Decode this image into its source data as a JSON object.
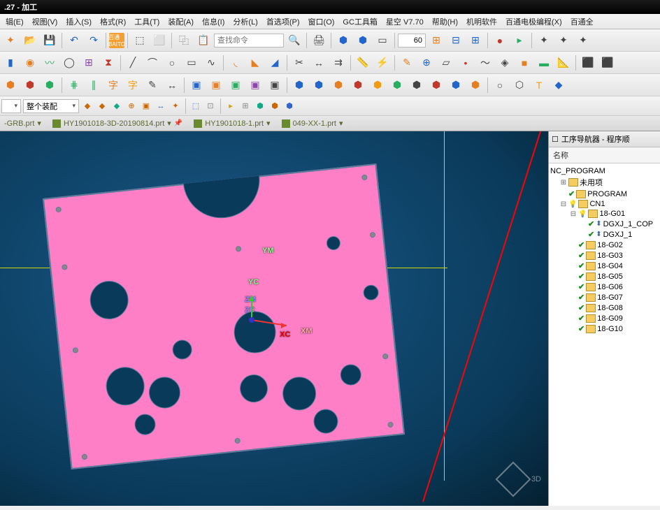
{
  "title": ".27 - 加工",
  "menu": [
    "辑(E)",
    "视图(V)",
    "插入(S)",
    "格式(R)",
    "工具(T)",
    "装配(A)",
    "信息(I)",
    "分析(L)",
    "首选项(P)",
    "窗口(O)",
    "GC工具箱",
    "星空 V7.70",
    "帮助(H)",
    "机明软件",
    "百通电极编程(X)",
    "百通全"
  ],
  "search": {
    "placeholder": "查找命令"
  },
  "numeric": {
    "value": "60"
  },
  "assembly": {
    "selected": "整个装配",
    "empty": ""
  },
  "tabs": [
    {
      "label": "-GRB.prt"
    },
    {
      "label": "HY1901018-3D-20190814.prt"
    },
    {
      "label": "HY1901018-1.prt"
    },
    {
      "label": "049-XX-1.prt"
    }
  ],
  "axes": {
    "ym": "YM",
    "yc": "YC",
    "zm": "ZM",
    "zc": "ZC",
    "xc": "XC",
    "xm": "XM"
  },
  "panel": {
    "title": "工序导航器 - 程序顺",
    "header": "名称",
    "root": "NC_PROGRAM",
    "unused": "未用项",
    "program": "PROGRAM",
    "cn1": "CN1",
    "g01": "18-G01",
    "ops": [
      "DGXJ_1_COP",
      "DGXJ_1"
    ],
    "groups": [
      "18-G02",
      "18-G03",
      "18-G04",
      "18-G05",
      "18-G06",
      "18-G07",
      "18-G08",
      "18-G09",
      "18-G10"
    ]
  },
  "watermark": {
    "text": "3D",
    "sub": ""
  }
}
